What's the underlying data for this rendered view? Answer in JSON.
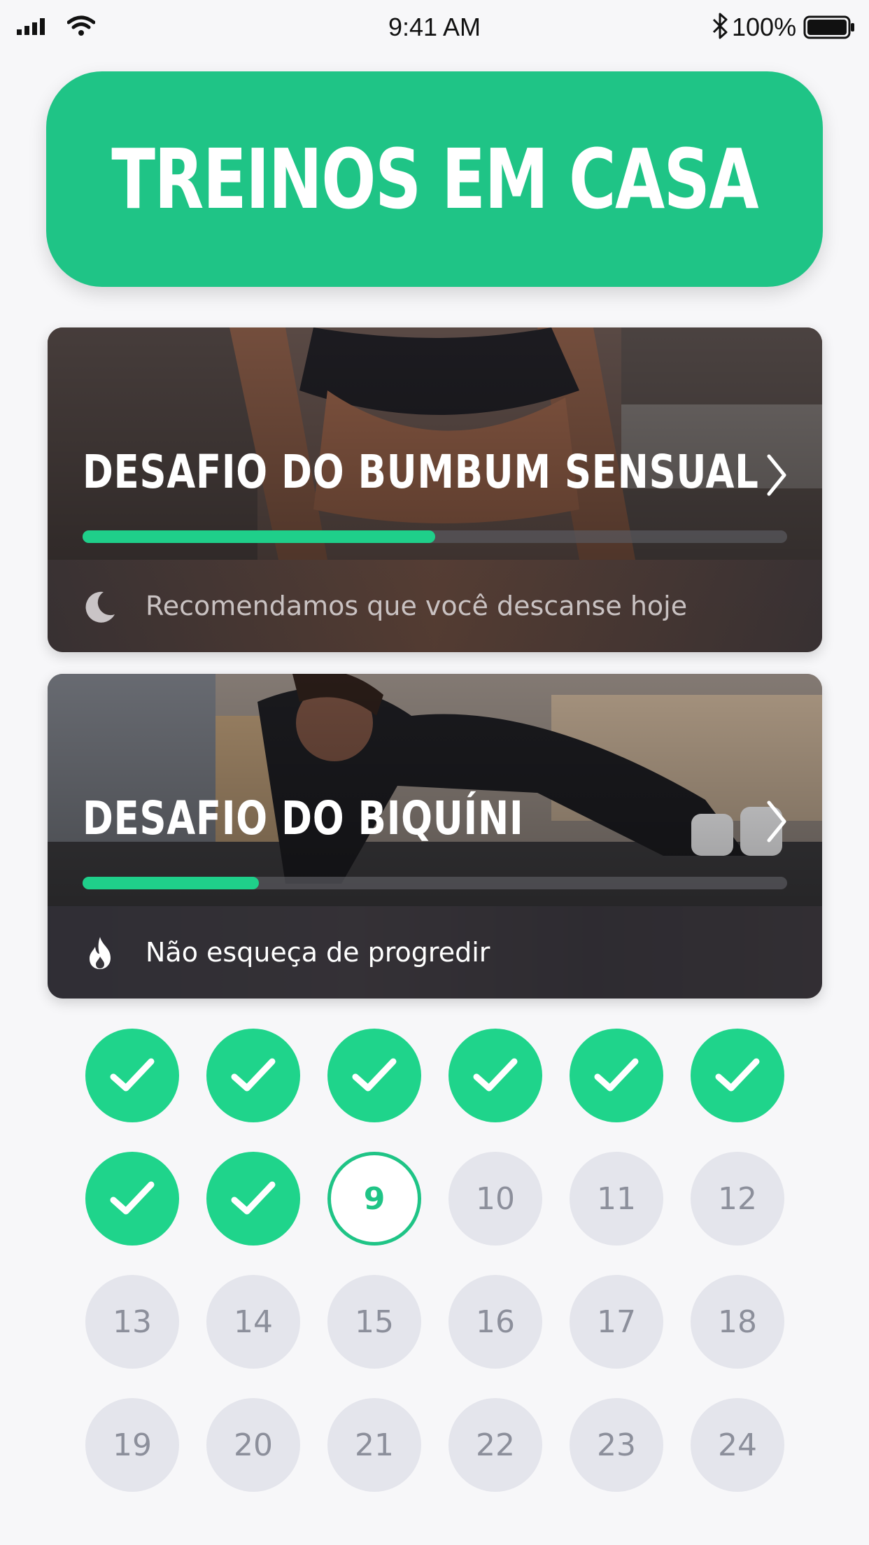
{
  "status_bar": {
    "time": "9:41 AM",
    "battery": "100%",
    "icons": [
      "signal-icon",
      "wifi-icon",
      "bluetooth-icon",
      "battery-icon"
    ]
  },
  "header": {
    "title": "TREINOS EM CASA"
  },
  "colors": {
    "accent": "#1fc486",
    "day_done": "#1fd48b",
    "day_pending": "#e4e5ec"
  },
  "cards": [
    {
      "title": "DESAFIO DO BUMBUM SENSUAL",
      "progress": 0.5,
      "footer_icon": "moon-icon",
      "footer_text": "Recomendamos que você descanse hoje"
    },
    {
      "title": "DESAFIO DO BIQUÍNI",
      "progress": 0.25,
      "footer_icon": "flame-icon",
      "footer_text": "Não esqueça de progredir"
    }
  ],
  "days": [
    {
      "label": "1",
      "state": "done"
    },
    {
      "label": "2",
      "state": "done"
    },
    {
      "label": "3",
      "state": "done"
    },
    {
      "label": "4",
      "state": "done"
    },
    {
      "label": "5",
      "state": "done"
    },
    {
      "label": "6",
      "state": "done"
    },
    {
      "label": "7",
      "state": "done"
    },
    {
      "label": "8",
      "state": "done"
    },
    {
      "label": "9",
      "state": "current"
    },
    {
      "label": "10",
      "state": "pending"
    },
    {
      "label": "11",
      "state": "pending"
    },
    {
      "label": "12",
      "state": "pending"
    },
    {
      "label": "13",
      "state": "pending"
    },
    {
      "label": "14",
      "state": "pending"
    },
    {
      "label": "15",
      "state": "pending"
    },
    {
      "label": "16",
      "state": "pending"
    },
    {
      "label": "17",
      "state": "pending"
    },
    {
      "label": "18",
      "state": "pending"
    },
    {
      "label": "19",
      "state": "pending"
    },
    {
      "label": "20",
      "state": "pending"
    },
    {
      "label": "21",
      "state": "pending"
    },
    {
      "label": "22",
      "state": "pending"
    },
    {
      "label": "23",
      "state": "pending"
    },
    {
      "label": "24",
      "state": "pending"
    }
  ]
}
